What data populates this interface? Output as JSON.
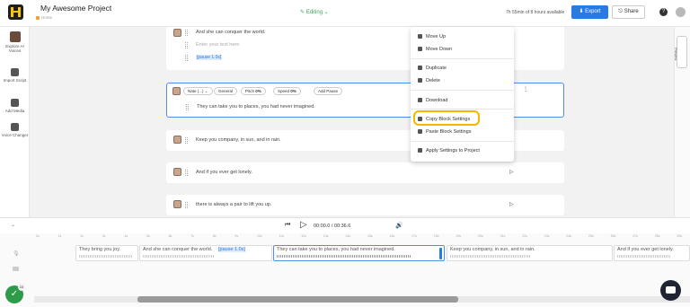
{
  "header": {
    "project_title": "My Awesome Project",
    "breadcrumb": "Home",
    "status": "Editing",
    "usage": "7h 55min of 8 hours available",
    "export_label": "Export",
    "share_label": "Share"
  },
  "sidebar": {
    "items": [
      {
        "label": "Explore AI Voices",
        "icon": "voice-avatar-icon"
      },
      {
        "label": "Import Script",
        "icon": "import-icon"
      },
      {
        "label": "Add Media",
        "icon": "media-icon"
      },
      {
        "label": "Voice Changer",
        "icon": "voice-changer-icon"
      }
    ]
  },
  "blocks": [
    {
      "lines": [
        "And she can conquer the world.",
        "Enter your text here",
        "[pause 1.0s]"
      ]
    },
    {
      "voice": "Nate (...)",
      "controls": {
        "general": "General",
        "pitch_label": "Pitch",
        "pitch_value": "0%",
        "speed_label": "Speed",
        "speed_value": "0%",
        "add_pause": "Add Pause"
      },
      "text": "They can take you to places, you had never imagined."
    },
    {
      "text": "Keep you company, in sun, and in rain."
    },
    {
      "text": "And if you ever get lonely."
    },
    {
      "text": "there is always a pair to lift you up."
    }
  ],
  "context_menu": {
    "items": [
      "Move Up",
      "Move Down",
      "Duplicate",
      "Delete",
      "Download",
      "Copy Block Settings",
      "Paste Block Settings",
      "Apply Settings to Project"
    ],
    "highlighted": "Copy Block Settings",
    "highlight_color": "#f7b500"
  },
  "right_rail": {
    "preview_label": "Preview"
  },
  "player": {
    "time": "00:00.0 / 00:36.6"
  },
  "timeline": {
    "ticks": [
      "0s",
      "1s",
      "2s",
      "3s",
      "4s",
      "5s",
      "6s",
      "7s",
      "8s",
      "9s",
      "10s",
      "11s",
      "12s",
      "13s",
      "14s",
      "15s",
      "16s",
      "17s",
      "18s",
      "19s",
      "20s",
      "21s",
      "22s",
      "23s",
      "24s",
      "25s",
      "26s",
      "27s",
      "28s",
      "29s"
    ],
    "clips": [
      "They bring you joy.",
      "And she can conquer the world.",
      "[pause 1.0s]",
      "They can take you to places, you had never imagined.",
      "Keep you company, in sun, and in rain.",
      "And if you ever get lonely."
    ]
  },
  "status": {
    "count": "10"
  },
  "colors": {
    "accent": "#2a7ae4",
    "editing": "#3aa758",
    "badge": "#2e9b4a"
  }
}
